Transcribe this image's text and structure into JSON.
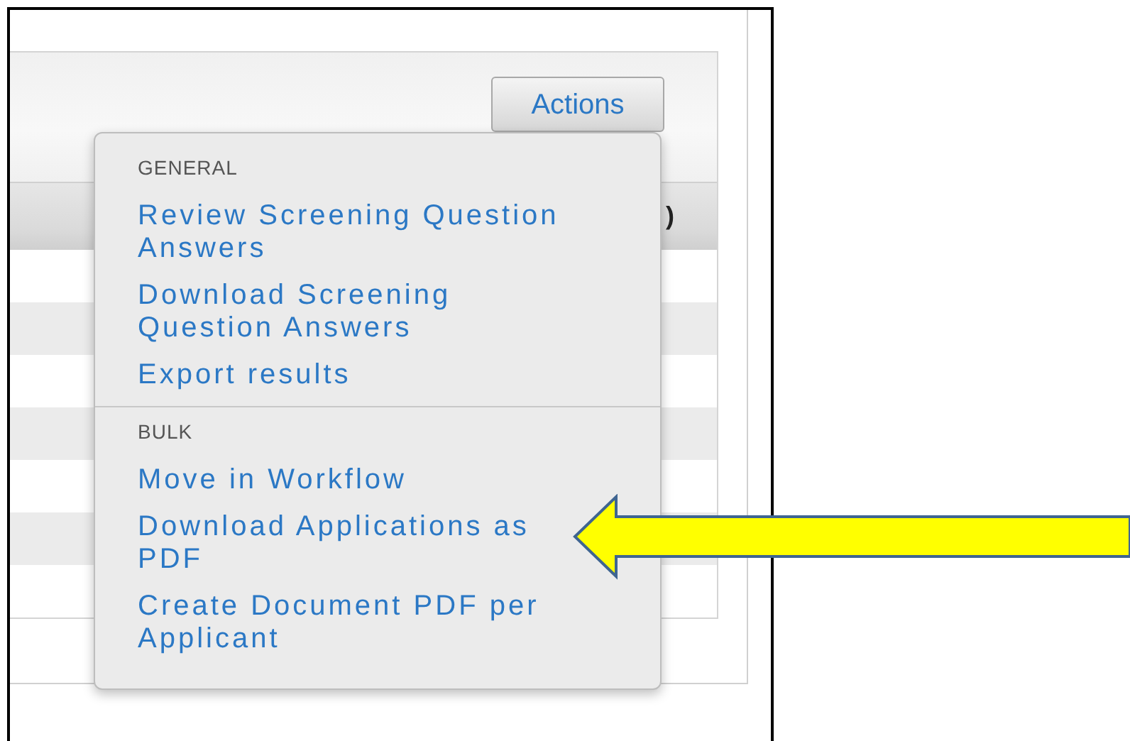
{
  "toolbar": {
    "actions_button": "Actions"
  },
  "table": {
    "header_text": ")"
  },
  "menu": {
    "sections": [
      {
        "heading": "GENERAL",
        "items": [
          "Review Screening Question Answers",
          "Download Screening Question Answers",
          "Export results"
        ]
      },
      {
        "heading": "BULK",
        "items": [
          "Move in Workflow",
          "Download Applications as PDF",
          "Create Document PDF per Applicant"
        ]
      }
    ]
  },
  "callout": {
    "kind": "arrow"
  }
}
